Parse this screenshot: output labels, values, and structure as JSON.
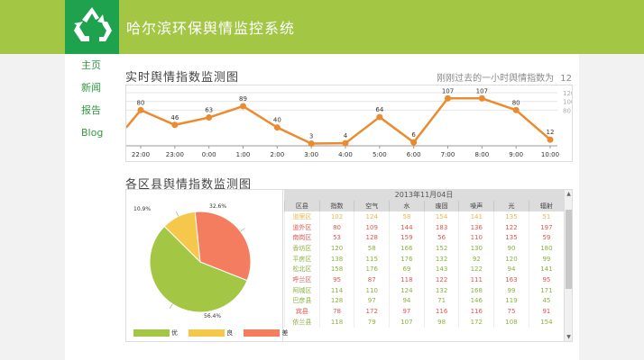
{
  "header": {
    "title": "哈尔滨环保舆情监控系统"
  },
  "nav": [
    "主页",
    "新闻",
    "报告",
    "Blog"
  ],
  "realtime": {
    "title": "实时舆情指数监测图",
    "hint_label": "刚刚过去的一小时舆情指数为",
    "hint_value": "12"
  },
  "chart_data": [
    {
      "type": "line",
      "x": [
        "22:00",
        "23:00",
        "0:00",
        "1:00",
        "2:00",
        "3:00",
        "4:00",
        "5:00",
        "6:00",
        "7:00",
        "8:00",
        "9:00",
        "10:00"
      ],
      "series": [
        {
          "values": [
            80,
            46,
            63,
            89,
            40,
            3,
            4,
            64,
            6,
            107,
            107,
            80,
            12
          ]
        }
      ],
      "y_ticks": [
        "120",
        "100",
        "80"
      ],
      "color": "#ec8a2f"
    },
    {
      "type": "pie",
      "categories": [
        "优",
        "良",
        "差"
      ],
      "values": [
        56.4,
        10.9,
        32.6
      ],
      "labels": [
        "56.4%",
        "10.9%",
        "32.6%"
      ],
      "colors": [
        "#a3c645",
        "#f5c84b",
        "#f47c5f"
      ]
    }
  ],
  "district": {
    "title": "各区县舆情指数监测图",
    "date": "2013年11月04日",
    "headers": [
      "区县",
      "指数",
      "空气",
      "水",
      "废固",
      "噪声",
      "光",
      "辐射"
    ],
    "rows": [
      [
        "道里区",
        "102",
        "124",
        "58",
        "154",
        "141",
        "135",
        "51"
      ],
      [
        "道外区",
        "80",
        "109",
        "144",
        "183",
        "136",
        "122",
        "197"
      ],
      [
        "南岗区",
        "53",
        "128",
        "159",
        "56",
        "110",
        "135",
        "59"
      ],
      [
        "香坊区",
        "120",
        "58",
        "166",
        "152",
        "130",
        "90",
        "180"
      ],
      [
        "平房区",
        "138",
        "115",
        "176",
        "132",
        "92",
        "120",
        "99"
      ],
      [
        "松北区",
        "158",
        "176",
        "69",
        "143",
        "122",
        "94",
        "141"
      ],
      [
        "呼兰区",
        "95",
        "87",
        "118",
        "122",
        "111",
        "163",
        "95"
      ],
      [
        "阿城区",
        "114",
        "110",
        "124",
        "132",
        "168",
        "99",
        "171"
      ],
      [
        "巴彦县",
        "128",
        "97",
        "94",
        "71",
        "146",
        "119",
        "45"
      ],
      [
        "宾县",
        "78",
        "172",
        "97",
        "116",
        "116",
        "75",
        "91"
      ],
      [
        "依兰县",
        "118",
        "79",
        "107",
        "98",
        "172",
        "108",
        "154"
      ]
    ],
    "row_colors": [
      "#e8b84d",
      "#e0574f",
      "#e0574f",
      "#8ab33e",
      "#8ab33e",
      "#8ab33e",
      "#e0574f",
      "#8ab33e",
      "#8ab33e",
      "#e0574f",
      "#8ab33e"
    ]
  }
}
